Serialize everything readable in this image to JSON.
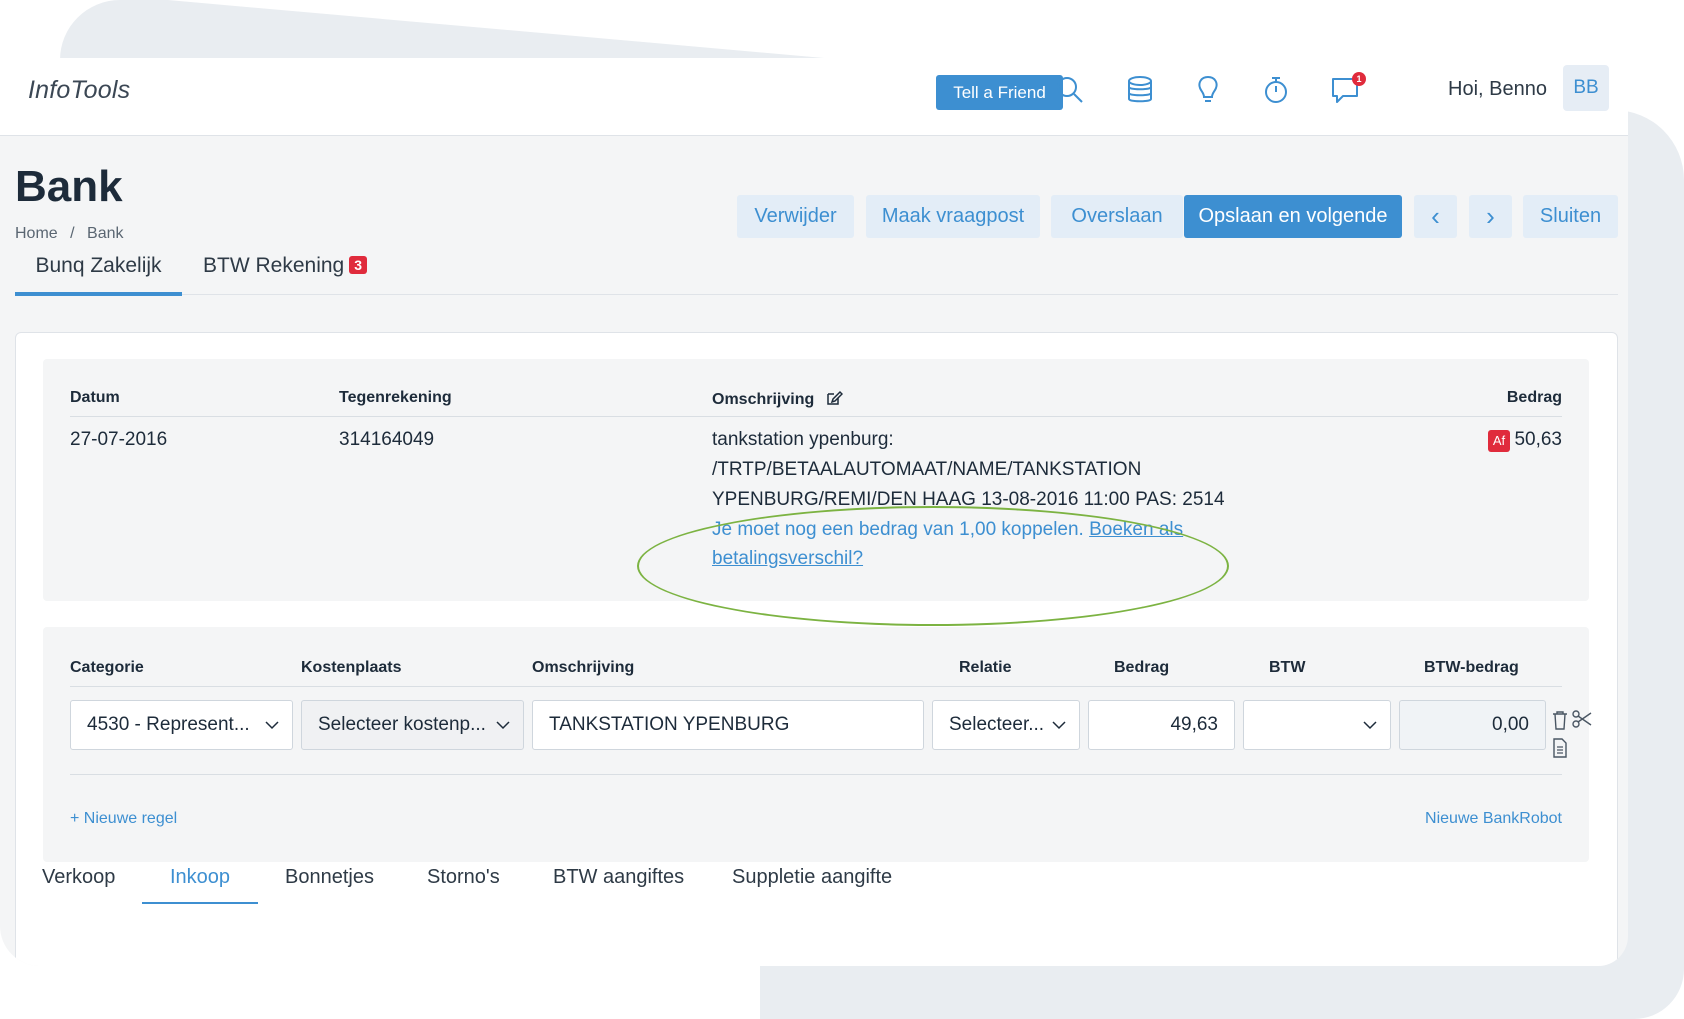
{
  "app": {
    "brand": "InfoTools"
  },
  "topbar": {
    "tell_friend": "Tell a Friend",
    "notifications_count": "1",
    "greeting": "Hoi, Benno",
    "avatar_initials": "BB"
  },
  "page": {
    "title": "Bank",
    "breadcrumb": [
      "Home",
      "/",
      "Bank"
    ]
  },
  "actions": {
    "delete": "Verwijder",
    "question": "Maak vraagpost",
    "skip": "Overslaan",
    "save_next": "Opslaan en volgende",
    "prev": "‹",
    "next": "›",
    "close": "Sluiten"
  },
  "account_tabs": [
    {
      "label": "Bunq Zakelijk",
      "active": true
    },
    {
      "label": "BTW Rekening",
      "badge": "3",
      "active": false
    }
  ],
  "transaction": {
    "headers": {
      "date": "Datum",
      "counter": "Tegenrekening",
      "description": "Omschrijving",
      "amount": "Bedrag"
    },
    "date": "27-07-2016",
    "counter_account": "314164049",
    "description_lines": [
      "tankstation ypenburg:",
      "/TRTP/BETAALAUTOMAAT/NAME/TANKSTATION",
      "YPENBURG/REMI/DEN HAAG 13-08-2016 11:00 PAS: 2514"
    ],
    "notice_text": "Je moet nog een bedrag van 1,00 koppelen. ",
    "notice_link_1": "Boeken als",
    "notice_link_2": "betalingsverschil?",
    "direction_badge": "Af",
    "amount": "50,63"
  },
  "booking": {
    "headers": {
      "category": "Categorie",
      "cost_center": "Kostenplaats",
      "description": "Omschrijving",
      "relation": "Relatie",
      "amount": "Bedrag",
      "vat": "BTW",
      "vat_amount": "BTW-bedrag"
    },
    "row": {
      "category": "4530 - Represent...",
      "cost_center": "Selecteer kostenp...",
      "description": "TANKSTATION YPENBURG",
      "relation": "Selecteer...",
      "amount": "49,63",
      "vat": "",
      "vat_amount": "0,00"
    },
    "new_line": "+ Nieuwe regel",
    "new_bankrobot": "Nieuwe BankRobot"
  },
  "bottom_tabs": [
    {
      "label": "Verkoop",
      "active": false
    },
    {
      "label": "Inkoop",
      "active": true
    },
    {
      "label": "Bonnetjes",
      "active": false
    },
    {
      "label": "Storno's",
      "active": false
    },
    {
      "label": "BTW aangiftes",
      "active": false
    },
    {
      "label": "Suppletie aangifte",
      "active": false
    }
  ],
  "colors": {
    "accent": "#3d8fd1",
    "danger": "#e02b3c",
    "highlight": "#7cb342"
  }
}
